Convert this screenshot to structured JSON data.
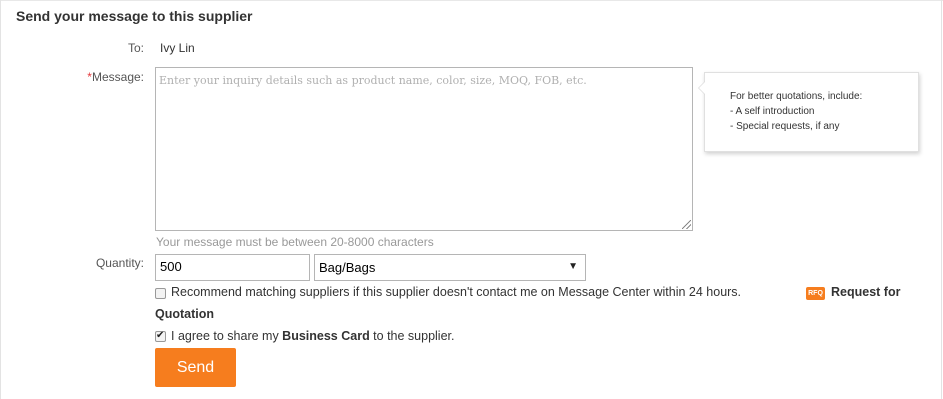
{
  "form": {
    "title": "Send your message to this supplier",
    "to_label": "To:",
    "to_value": "Ivy Lin",
    "message_star": "*",
    "message_label": "Message:",
    "message_placeholder": "Enter your inquiry details such as product name, color, size, MOQ, FOB, etc.",
    "message_hint": "Your message must be between 20-8000 characters",
    "quantity_label": "Quantity:",
    "quantity_value": "500",
    "unit_selected": "Bag/Bags",
    "recommend_text": "Recommend matching suppliers if this supplier doesn't contact me on Message Center within 24 hours.",
    "recommend_checked": false,
    "rfq_badge": "RFQ",
    "rfq_link_line1": "Request for",
    "rfq_link_line2": "Quotation",
    "agree_prefix": "I agree to share my ",
    "agree_bold": "Business Card",
    "agree_suffix": " to the supplier.",
    "agree_checked": true,
    "send_label": "Send"
  },
  "tooltip": {
    "heading": "For better quotations, include:",
    "items": [
      "- A self introduction",
      "- Special requests, if any"
    ]
  },
  "colors": {
    "accent": "#f67d1e",
    "required_star": "#e4393c",
    "hint": "#999999"
  }
}
